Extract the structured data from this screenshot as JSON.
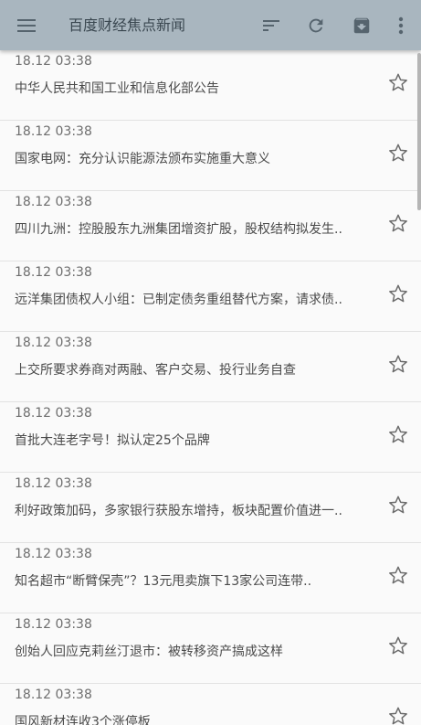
{
  "app": {
    "title": "百度财经焦点新闻",
    "accent_color": "#a9b6bf"
  },
  "toolbar": {
    "icons": [
      "menu-icon",
      "sort-icon",
      "refresh-icon",
      "archive-icon",
      "more-vert-icon"
    ]
  },
  "news": [
    {
      "time": "18.12 03:38",
      "headline": "中华人民共和国工业和信息化部公告"
    },
    {
      "time": "18.12 03:38",
      "headline": "国家电网：充分认识能源法颁布实施重大意义"
    },
    {
      "time": "18.12 03:38",
      "headline": "四川九洲：控股股东九洲集团增资扩股，股权结构拟发生.."
    },
    {
      "time": "18.12 03:38",
      "headline": "远洋集团债权人小组：已制定债务重组替代方案，请求债.."
    },
    {
      "time": "18.12 03:38",
      "headline": "上交所要求券商对两融、客户交易、投行业务自查"
    },
    {
      "time": "18.12 03:38",
      "headline": "首批大连老字号！拟认定25个品牌"
    },
    {
      "time": "18.12 03:38",
      "headline": "利好政策加码，多家银行获股东增持，板块配置价值进一.."
    },
    {
      "time": "18.12 03:38",
      "headline": "知名超市“断臂保壳”？13元甩卖旗下13家公司连带.."
    },
    {
      "time": "18.12 03:38",
      "headline": "创始人回应克莉丝汀退市：被转移资产搞成这样"
    },
    {
      "time": "18.12 03:38",
      "headline": "国风新材连收3个涨停板"
    }
  ]
}
